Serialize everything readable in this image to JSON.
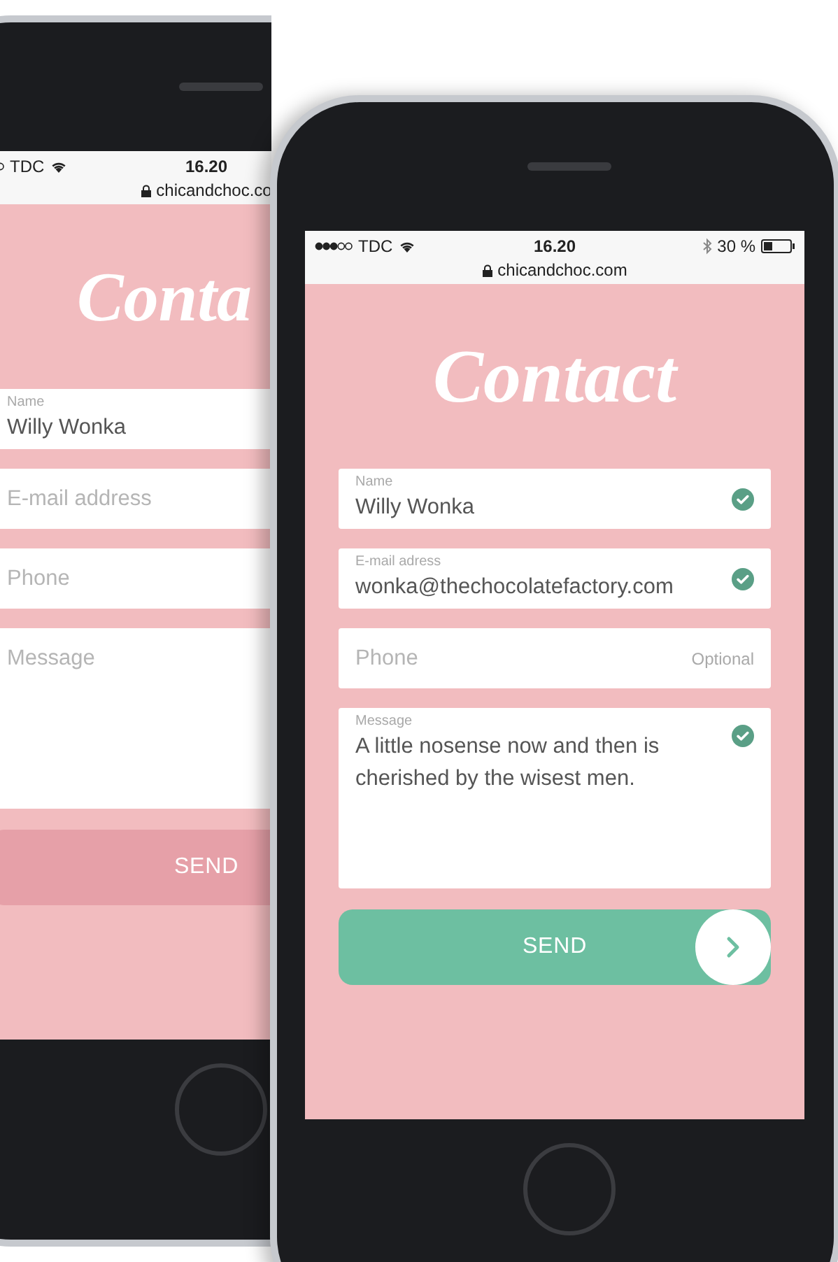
{
  "phones": [
    {
      "status": {
        "carrier": "TDC",
        "time": "16.20",
        "url": "chicandchoc.co"
      },
      "logo": "Conta",
      "fields": [
        {
          "kind": "line",
          "label": "Name",
          "value": "Willy Wonka",
          "valid": false
        },
        {
          "kind": "line",
          "placeholder": "E-mail address",
          "valid": false
        },
        {
          "kind": "line",
          "placeholder": "Phone",
          "valid": false
        },
        {
          "kind": "area",
          "placeholder": "Message",
          "valid": false
        }
      ],
      "send": {
        "label": "SEND",
        "disabled": true
      }
    },
    {
      "status": {
        "carrier": "TDC",
        "time": "16.20",
        "battery": "30 %",
        "url": "chicandchoc.com"
      },
      "logo": "Contact",
      "fields": [
        {
          "kind": "line",
          "label": "Name",
          "value": "Willy Wonka",
          "valid": true
        },
        {
          "kind": "line",
          "label": "E-mail adress",
          "value": "wonka@thechocolatefactory.com",
          "valid": true
        },
        {
          "kind": "line",
          "placeholder": "Phone",
          "hint": "Optional",
          "valid": false
        },
        {
          "kind": "area",
          "label": "Message",
          "value": "A little nosense now and then is cherished by the wisest men.",
          "valid": true
        }
      ],
      "send": {
        "label": "SEND",
        "disabled": false
      }
    }
  ]
}
